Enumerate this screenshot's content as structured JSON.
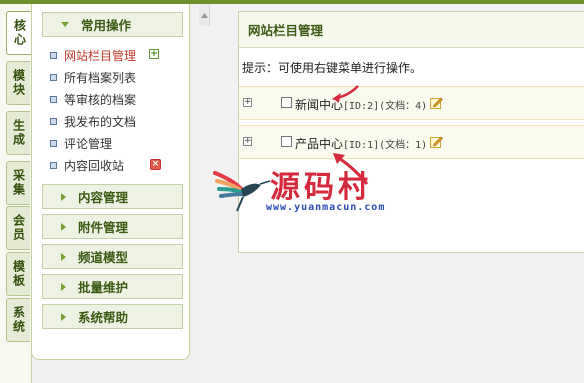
{
  "left_tabs": [
    "核心",
    "模块",
    "生成",
    "采集",
    "会员",
    "模板",
    "系统"
  ],
  "menu": {
    "open_group": "常用操作",
    "items": [
      {
        "label": "网站栏目管理",
        "highlight": true,
        "icon": "add-icon"
      },
      {
        "label": "所有档案列表"
      },
      {
        "label": "等审核的档案"
      },
      {
        "label": "我发布的文档"
      },
      {
        "label": "评论管理"
      },
      {
        "label": "内容回收站",
        "icon": "delete-icon"
      }
    ],
    "collapsed_groups": [
      "内容管理",
      "附件管理",
      "频道模型",
      "批量维护",
      "系统帮助"
    ]
  },
  "main": {
    "title": "网站栏目管理",
    "hint": "提示：可使用右键菜单进行操作。",
    "rows": [
      {
        "name": "新闻中心",
        "meta": "[ID:2](文档：4)"
      },
      {
        "name": "产品中心",
        "meta": "[ID:1](文档：1)"
      }
    ]
  },
  "watermark": {
    "text": "源码村",
    "url": "www.yuanmacun.com"
  },
  "colors": {
    "accent": "#6d8f2c",
    "header_text": "#3b5a13",
    "highlight": "#c0392b",
    "watermark": "#d42a3c"
  }
}
